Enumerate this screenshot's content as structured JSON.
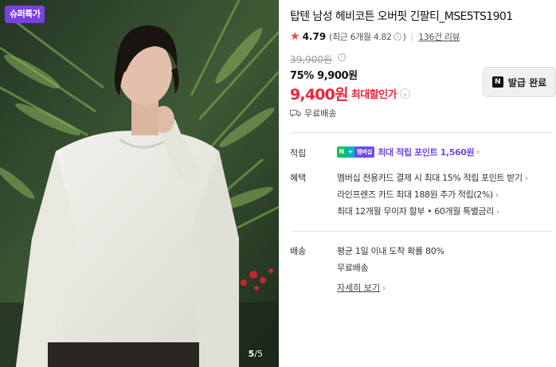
{
  "image": {
    "badge": "슈퍼특가",
    "counter_current": "5",
    "counter_total": "/5"
  },
  "product": {
    "title": "탑텐 남성 헤비코튼 오버핏 긴팔티_MSE5TS1901",
    "rating_icon": "star-icon",
    "rating": "4.79",
    "recent_rating": "(최근 6개월 4.82",
    "recent_rating_close": ")",
    "info_icon_glyph": "i",
    "review_count": "136건 리뷰",
    "original_price": "39,900원",
    "discount_percent": "75%",
    "sale_price": "9,900원",
    "max_discount_price": "9,400원",
    "max_discount_label": "최대할인가",
    "max_chevron": "⌄",
    "shipping_badge": "무료배송"
  },
  "coupon_button": {
    "logo": "N",
    "label": "발급 완료"
  },
  "points": {
    "label": "적립",
    "badge_n": "N",
    "badge_plus": "+",
    "badge_membership": "멤버십",
    "text": "최대 적립 포인트 1,560원"
  },
  "benefits": {
    "label": "혜택",
    "items": [
      "멤버십 전용카드 결제 시 최대 15% 적립 포인트 받기",
      "라인프렌즈 카드 최대 188원 추가 적립(2%)",
      "최대 12개월 무이자 할부 • 60개월 특별금리"
    ]
  },
  "delivery": {
    "label": "배송",
    "line1": "평균 1일 이내 도착 확률 80%",
    "line2": "무료배송",
    "detail_link": "자세히 보기"
  },
  "colors": {
    "accent_red": "#f0233b",
    "badge_purple": "#7b3fe4",
    "points_purple": "#6c4be8",
    "naver_green": "#03c75a"
  }
}
